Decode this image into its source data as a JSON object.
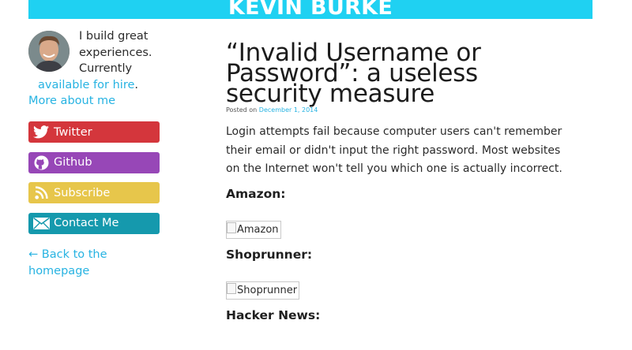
{
  "site": {
    "title": "KEVIN BURKE"
  },
  "sidebar": {
    "bio_text": "I build great experiences. Currently",
    "bio_link_hire": "available for hire",
    "bio_sep": ".",
    "bio_link_more": "More about me",
    "buttons": [
      {
        "label": "Twitter",
        "icon": "twitter-icon",
        "color": "#d4363c"
      },
      {
        "label": "Github",
        "icon": "github-icon",
        "color": "#9747b7"
      },
      {
        "label": "Subscribe",
        "icon": "rss-icon",
        "color": "#e7c64b"
      },
      {
        "label": "Contact Me",
        "icon": "envelope-icon",
        "color": "#1599ad"
      }
    ],
    "back_link": "← Back to the homepage"
  },
  "post": {
    "title": "“Invalid Username or Password”: a useless security measure",
    "posted_prefix": "Posted on",
    "posted_date": "December 1, 2014",
    "intro": "Login attempts fail because computer users can't remember their email or didn't input the right password. Most websites on the Internet won't tell you which one is actually incorrect.",
    "sections": [
      {
        "heading": "Amazon:",
        "image_alt": "Amazon"
      },
      {
        "heading": "Shoprunner:",
        "image_alt": "Shoprunner"
      },
      {
        "heading": "Hacker News:"
      }
    ]
  },
  "colors": {
    "accent": "#1fd1f2",
    "link": "#27b3e2"
  }
}
